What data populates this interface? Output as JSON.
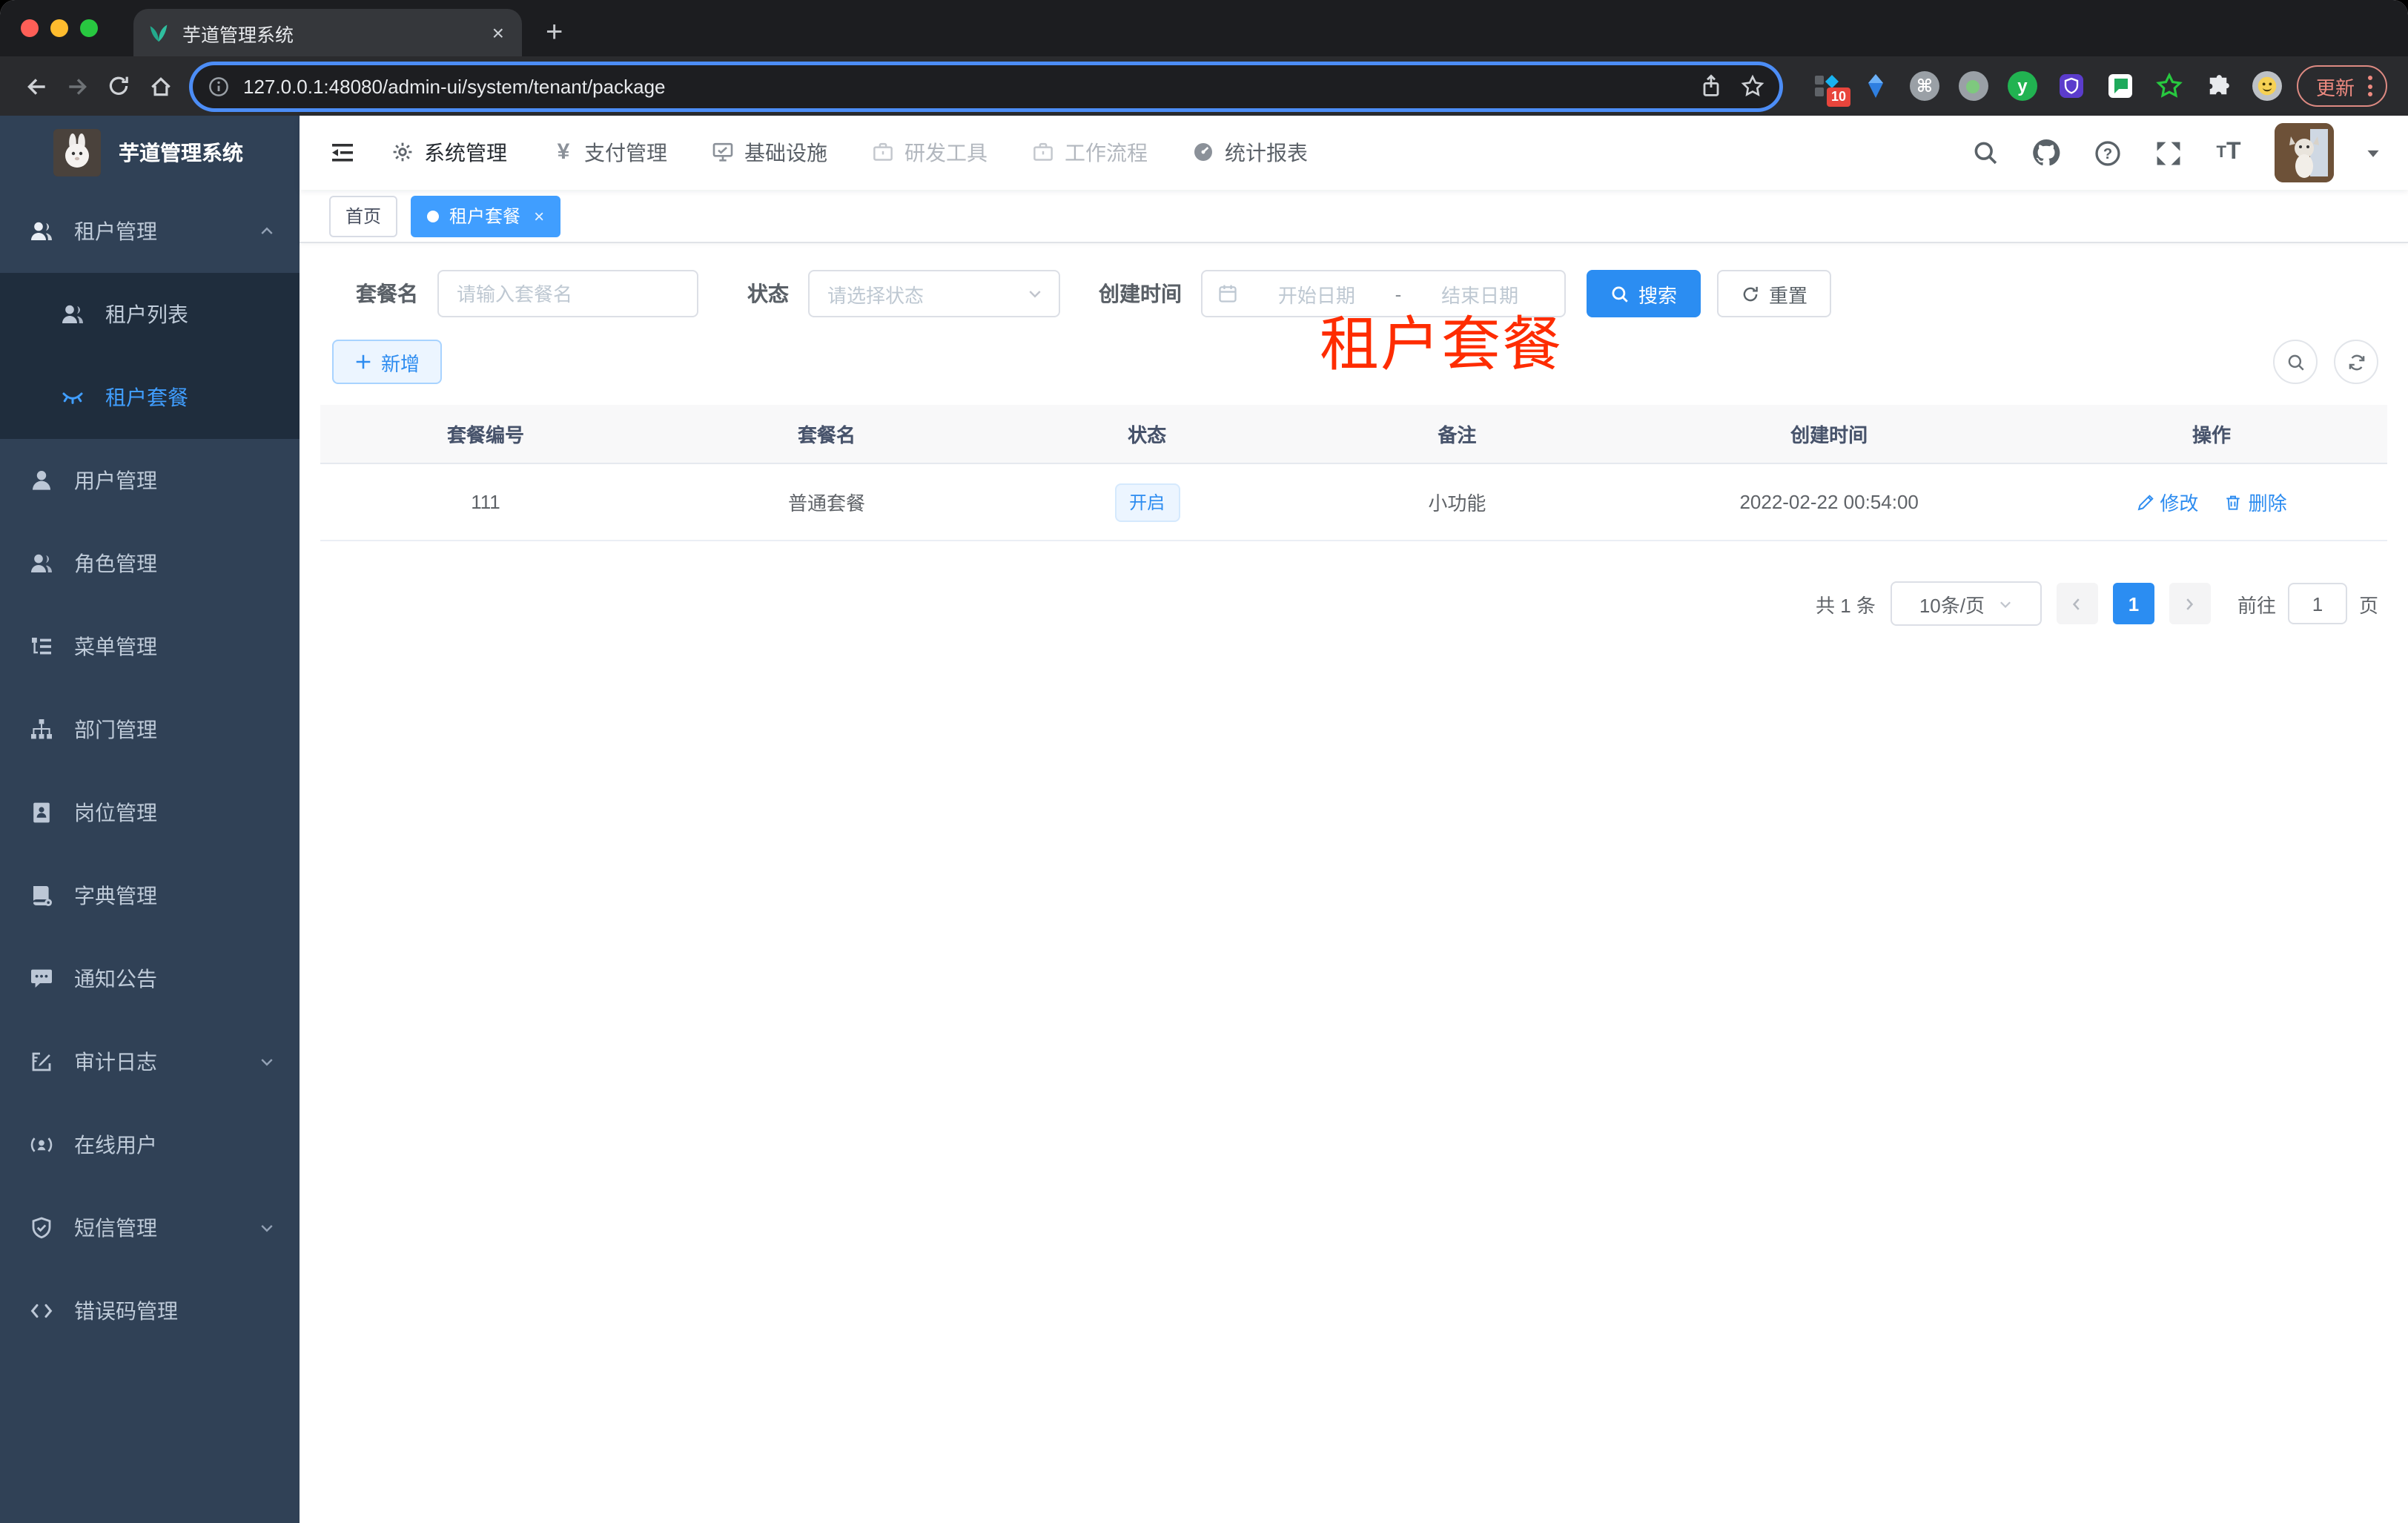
{
  "browser": {
    "tab_title": "芋道管理系统",
    "new_tab_glyph": "+",
    "close_glyph": "×",
    "url": "127.0.0.1:48080/admin-ui/system/tenant/package",
    "extension_badge": "10",
    "update_label": "更新"
  },
  "colors": {
    "accent_blue": "#2d8cf0",
    "tag_active_blue": "#409eff",
    "sidebar_bg": "#304156",
    "sidebar_submenu_bg": "#1f2d3d",
    "sidebar_text": "#bfcbd9",
    "overlay_red": "#fe2c00",
    "status_tag_bg": "#ecf5ff",
    "traffic_red": "#ff5f57",
    "traffic_yellow": "#febc2e",
    "traffic_green": "#28c840"
  },
  "sidebar": {
    "logo_title": "芋道管理系统",
    "items": [
      {
        "label": "租户管理"
      },
      {
        "label": "租户列表"
      },
      {
        "label": "租户套餐"
      },
      {
        "label": "用户管理"
      },
      {
        "label": "角色管理"
      },
      {
        "label": "菜单管理"
      },
      {
        "label": "部门管理"
      },
      {
        "label": "岗位管理"
      },
      {
        "label": "字典管理"
      },
      {
        "label": "通知公告"
      },
      {
        "label": "审计日志"
      },
      {
        "label": "在线用户"
      },
      {
        "label": "短信管理"
      },
      {
        "label": "错误码管理"
      }
    ]
  },
  "topnav": {
    "items": [
      {
        "label": "系统管理"
      },
      {
        "label": "支付管理"
      },
      {
        "label": "基础设施"
      },
      {
        "label": "研发工具"
      },
      {
        "label": "工作流程"
      },
      {
        "label": "统计报表"
      }
    ]
  },
  "tags": {
    "home": "首页",
    "active": "租户套餐"
  },
  "page_title_overlay": "租户套餐",
  "filters": {
    "name_label": "套餐名",
    "name_placeholder": "请输入套餐名",
    "status_label": "状态",
    "status_placeholder": "请选择状态",
    "date_label": "创建时间",
    "date_start_placeholder": "开始日期",
    "date_separator": "-",
    "date_end_placeholder": "结束日期",
    "search_label": "搜索",
    "reset_label": "重置",
    "add_label": "新增"
  },
  "table": {
    "headers": [
      "套餐编号",
      "套餐名",
      "状态",
      "备注",
      "创建时间",
      "操作"
    ],
    "rows": [
      {
        "id": "111",
        "name": "普通套餐",
        "status": "开启",
        "remark": "小功能",
        "created": "2022-02-22 00:54:00",
        "edit_label": "修改",
        "delete_label": "删除"
      }
    ]
  },
  "pagination": {
    "total": "共 1 条",
    "page_size": "10条/页",
    "current_page": "1",
    "goto_prefix": "前往",
    "goto_value": "1",
    "goto_suffix": "页"
  }
}
